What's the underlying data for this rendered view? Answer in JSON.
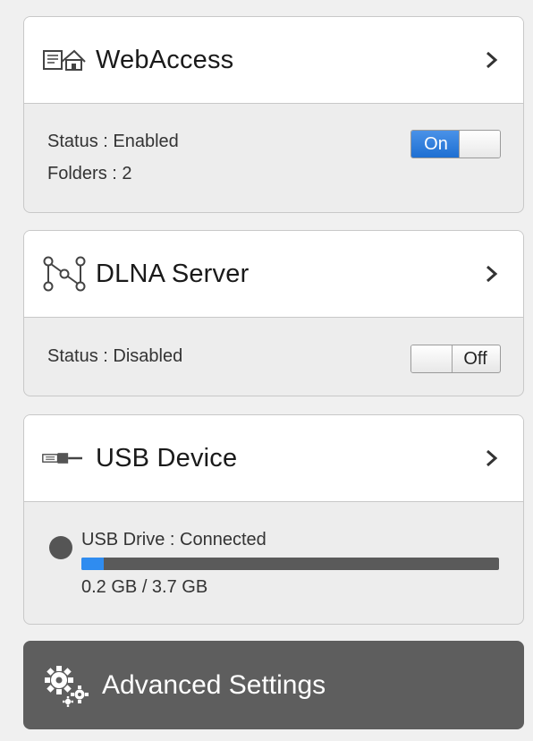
{
  "webaccess": {
    "title": "WebAccess",
    "status": "Status : Enabled",
    "folders": "Folders : 2",
    "toggle_label": "On",
    "toggle_state": "on"
  },
  "dlna": {
    "title": "DLNA Server",
    "status": "Status : Disabled",
    "toggle_label": "Off",
    "toggle_state": "off"
  },
  "usb": {
    "title": "USB Device",
    "drive_status": "USB Drive : Connected",
    "usage": "0.2 GB / 3.7 GB",
    "used_fraction": 0.054
  },
  "advanced": {
    "label": "Advanced Settings"
  },
  "icons": {
    "webaccess": "webaccess-icon",
    "dlna": "dlna-network-icon",
    "usb": "usb-connector-icon",
    "advanced": "gears-icon",
    "chevron": "chevron-right-icon"
  },
  "colors": {
    "toggle_on": "#1e6fd2",
    "progress_fill": "#2f8cf0",
    "advanced_bg": "#5e5e5e"
  }
}
